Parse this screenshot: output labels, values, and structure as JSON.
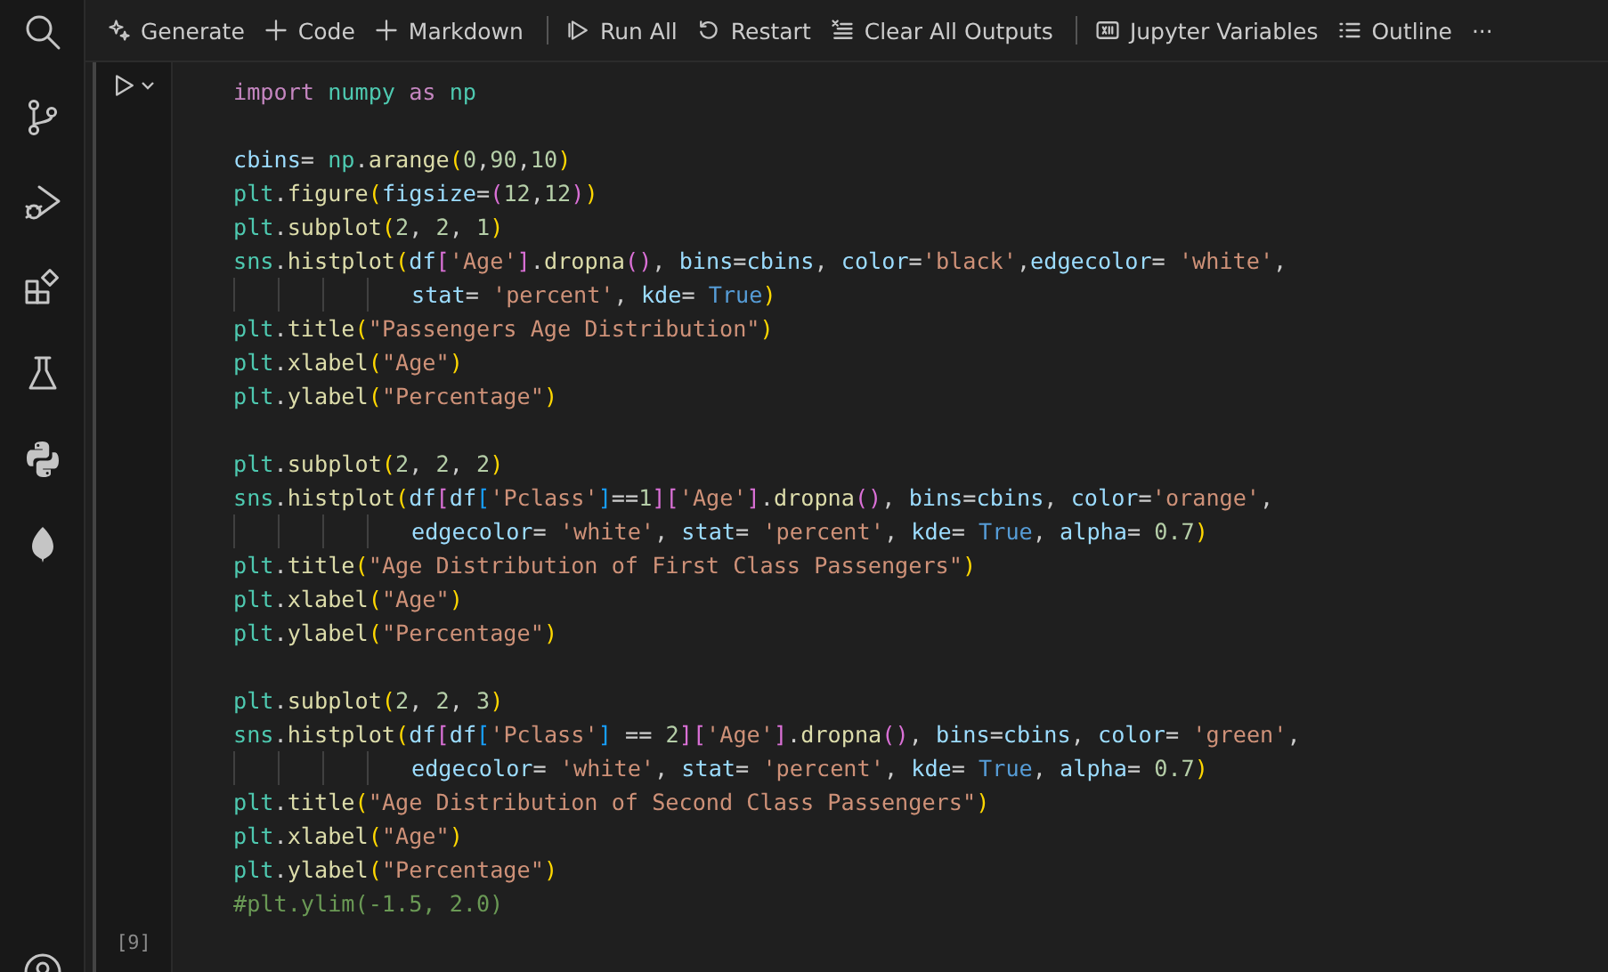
{
  "toolbar": {
    "groups": [
      {
        "items": [
          {
            "kind": "generate",
            "label": "Generate"
          },
          {
            "kind": "add",
            "label": "Code"
          },
          {
            "kind": "add",
            "label": "Markdown"
          }
        ]
      },
      {
        "items": [
          {
            "kind": "run-all",
            "label": "Run All"
          },
          {
            "kind": "restart",
            "label": "Restart"
          },
          {
            "kind": "clear",
            "label": "Clear All Outputs"
          }
        ]
      },
      {
        "items": [
          {
            "kind": "variables",
            "label": "Jupyter Variables"
          },
          {
            "kind": "outline",
            "label": "Outline"
          },
          {
            "kind": "more",
            "label": "···"
          }
        ]
      }
    ]
  },
  "cell": {
    "execution_count": "[9]",
    "lines": [
      {
        "kind": "code",
        "tokens": [
          {
            "kind": "kw",
            "text": "import "
          },
          {
            "kind": "mod",
            "text": "numpy "
          },
          {
            "kind": "kw",
            "text": "as "
          },
          {
            "kind": "mod",
            "text": "np"
          }
        ]
      },
      {
        "kind": "blank"
      },
      {
        "kind": "code",
        "tokens": [
          {
            "kind": "var",
            "text": "cbins"
          },
          {
            "kind": "p",
            "text": "= "
          },
          {
            "kind": "mod",
            "text": "np"
          },
          {
            "kind": "p",
            "text": "."
          },
          {
            "kind": "fn",
            "text": "arange"
          },
          {
            "kind": "b1",
            "text": "("
          },
          {
            "kind": "num",
            "text": "0"
          },
          {
            "kind": "p",
            "text": ","
          },
          {
            "kind": "num",
            "text": "90"
          },
          {
            "kind": "p",
            "text": ","
          },
          {
            "kind": "num",
            "text": "10"
          },
          {
            "kind": "b1",
            "text": ")"
          }
        ]
      },
      {
        "kind": "code",
        "tokens": [
          {
            "kind": "mod",
            "text": "plt"
          },
          {
            "kind": "p",
            "text": "."
          },
          {
            "kind": "fn",
            "text": "figure"
          },
          {
            "kind": "b1",
            "text": "("
          },
          {
            "kind": "var",
            "text": "figsize"
          },
          {
            "kind": "p",
            "text": "="
          },
          {
            "kind": "b2",
            "text": "("
          },
          {
            "kind": "num",
            "text": "12"
          },
          {
            "kind": "p",
            "text": ","
          },
          {
            "kind": "num",
            "text": "12"
          },
          {
            "kind": "b2",
            "text": ")"
          },
          {
            "kind": "b1",
            "text": ")"
          }
        ]
      },
      {
        "kind": "code",
        "tokens": [
          {
            "kind": "mod",
            "text": "plt"
          },
          {
            "kind": "p",
            "text": "."
          },
          {
            "kind": "fn",
            "text": "subplot"
          },
          {
            "kind": "b1",
            "text": "("
          },
          {
            "kind": "num",
            "text": "2"
          },
          {
            "kind": "p",
            "text": ", "
          },
          {
            "kind": "num",
            "text": "2"
          },
          {
            "kind": "p",
            "text": ", "
          },
          {
            "kind": "num",
            "text": "1"
          },
          {
            "kind": "b1",
            "text": ")"
          }
        ]
      },
      {
        "kind": "code",
        "tokens": [
          {
            "kind": "mod",
            "text": "sns"
          },
          {
            "kind": "p",
            "text": "."
          },
          {
            "kind": "fn",
            "text": "histplot"
          },
          {
            "kind": "b1",
            "text": "("
          },
          {
            "kind": "var",
            "text": "df"
          },
          {
            "kind": "b2",
            "text": "["
          },
          {
            "kind": "str",
            "text": "'Age'"
          },
          {
            "kind": "b2",
            "text": "]"
          },
          {
            "kind": "p",
            "text": "."
          },
          {
            "kind": "fn",
            "text": "dropna"
          },
          {
            "kind": "b2",
            "text": "()"
          },
          {
            "kind": "p",
            "text": ", "
          },
          {
            "kind": "var",
            "text": "bins"
          },
          {
            "kind": "p",
            "text": "="
          },
          {
            "kind": "var",
            "text": "cbins"
          },
          {
            "kind": "p",
            "text": ", "
          },
          {
            "kind": "var",
            "text": "color"
          },
          {
            "kind": "p",
            "text": "="
          },
          {
            "kind": "str",
            "text": "'black'"
          },
          {
            "kind": "p",
            "text": ","
          },
          {
            "kind": "var",
            "text": "edgecolor"
          },
          {
            "kind": "p",
            "text": "= "
          },
          {
            "kind": "str",
            "text": "'white'"
          },
          {
            "kind": "p",
            "text": ","
          }
        ]
      },
      {
        "kind": "continuation",
        "tokens": [
          {
            "kind": "var",
            "text": "stat"
          },
          {
            "kind": "p",
            "text": "= "
          },
          {
            "kind": "str",
            "text": "'percent'"
          },
          {
            "kind": "p",
            "text": ", "
          },
          {
            "kind": "var",
            "text": "kde"
          },
          {
            "kind": "p",
            "text": "= "
          },
          {
            "kind": "const",
            "text": "True"
          },
          {
            "kind": "b1",
            "text": ")"
          }
        ]
      },
      {
        "kind": "code",
        "tokens": [
          {
            "kind": "mod",
            "text": "plt"
          },
          {
            "kind": "p",
            "text": "."
          },
          {
            "kind": "fn",
            "text": "title"
          },
          {
            "kind": "b1",
            "text": "("
          },
          {
            "kind": "str",
            "text": "\"Passengers Age Distribution\""
          },
          {
            "kind": "b1",
            "text": ")"
          }
        ]
      },
      {
        "kind": "code",
        "tokens": [
          {
            "kind": "mod",
            "text": "plt"
          },
          {
            "kind": "p",
            "text": "."
          },
          {
            "kind": "fn",
            "text": "xlabel"
          },
          {
            "kind": "b1",
            "text": "("
          },
          {
            "kind": "str",
            "text": "\"Age\""
          },
          {
            "kind": "b1",
            "text": ")"
          }
        ]
      },
      {
        "kind": "code",
        "tokens": [
          {
            "kind": "mod",
            "text": "plt"
          },
          {
            "kind": "p",
            "text": "."
          },
          {
            "kind": "fn",
            "text": "ylabel"
          },
          {
            "kind": "b1",
            "text": "("
          },
          {
            "kind": "str",
            "text": "\"Percentage\""
          },
          {
            "kind": "b1",
            "text": ")"
          }
        ]
      },
      {
        "kind": "blank"
      },
      {
        "kind": "code",
        "tokens": [
          {
            "kind": "mod",
            "text": "plt"
          },
          {
            "kind": "p",
            "text": "."
          },
          {
            "kind": "fn",
            "text": "subplot"
          },
          {
            "kind": "b1",
            "text": "("
          },
          {
            "kind": "num",
            "text": "2"
          },
          {
            "kind": "p",
            "text": ", "
          },
          {
            "kind": "num",
            "text": "2"
          },
          {
            "kind": "p",
            "text": ", "
          },
          {
            "kind": "num",
            "text": "2"
          },
          {
            "kind": "b1",
            "text": ")"
          }
        ]
      },
      {
        "kind": "code",
        "tokens": [
          {
            "kind": "mod",
            "text": "sns"
          },
          {
            "kind": "p",
            "text": "."
          },
          {
            "kind": "fn",
            "text": "histplot"
          },
          {
            "kind": "b1",
            "text": "("
          },
          {
            "kind": "var",
            "text": "df"
          },
          {
            "kind": "b2",
            "text": "["
          },
          {
            "kind": "var",
            "text": "df"
          },
          {
            "kind": "b3",
            "text": "["
          },
          {
            "kind": "str",
            "text": "'Pclass'"
          },
          {
            "kind": "b3",
            "text": "]"
          },
          {
            "kind": "p",
            "text": "=="
          },
          {
            "kind": "num",
            "text": "1"
          },
          {
            "kind": "b2",
            "text": "]"
          },
          {
            "kind": "b2",
            "text": "["
          },
          {
            "kind": "str",
            "text": "'Age'"
          },
          {
            "kind": "b2",
            "text": "]"
          },
          {
            "kind": "p",
            "text": "."
          },
          {
            "kind": "fn",
            "text": "dropna"
          },
          {
            "kind": "b2",
            "text": "()"
          },
          {
            "kind": "p",
            "text": ", "
          },
          {
            "kind": "var",
            "text": "bins"
          },
          {
            "kind": "p",
            "text": "="
          },
          {
            "kind": "var",
            "text": "cbins"
          },
          {
            "kind": "p",
            "text": ", "
          },
          {
            "kind": "var",
            "text": "color"
          },
          {
            "kind": "p",
            "text": "="
          },
          {
            "kind": "str",
            "text": "'orange'"
          },
          {
            "kind": "p",
            "text": ","
          }
        ]
      },
      {
        "kind": "continuation",
        "tokens": [
          {
            "kind": "var",
            "text": "edgecolor"
          },
          {
            "kind": "p",
            "text": "= "
          },
          {
            "kind": "str",
            "text": "'white'"
          },
          {
            "kind": "p",
            "text": ", "
          },
          {
            "kind": "var",
            "text": "stat"
          },
          {
            "kind": "p",
            "text": "= "
          },
          {
            "kind": "str",
            "text": "'percent'"
          },
          {
            "kind": "p",
            "text": ", "
          },
          {
            "kind": "var",
            "text": "kde"
          },
          {
            "kind": "p",
            "text": "= "
          },
          {
            "kind": "const",
            "text": "True"
          },
          {
            "kind": "p",
            "text": ", "
          },
          {
            "kind": "var",
            "text": "alpha"
          },
          {
            "kind": "p",
            "text": "= "
          },
          {
            "kind": "num",
            "text": "0.7"
          },
          {
            "kind": "b1",
            "text": ")"
          }
        ]
      },
      {
        "kind": "code",
        "tokens": [
          {
            "kind": "mod",
            "text": "plt"
          },
          {
            "kind": "p",
            "text": "."
          },
          {
            "kind": "fn",
            "text": "title"
          },
          {
            "kind": "b1",
            "text": "("
          },
          {
            "kind": "str",
            "text": "\"Age Distribution of First Class Passengers\""
          },
          {
            "kind": "b1",
            "text": ")"
          }
        ]
      },
      {
        "kind": "code",
        "tokens": [
          {
            "kind": "mod",
            "text": "plt"
          },
          {
            "kind": "p",
            "text": "."
          },
          {
            "kind": "fn",
            "text": "xlabel"
          },
          {
            "kind": "b1",
            "text": "("
          },
          {
            "kind": "str",
            "text": "\"Age\""
          },
          {
            "kind": "b1",
            "text": ")"
          }
        ]
      },
      {
        "kind": "code",
        "tokens": [
          {
            "kind": "mod",
            "text": "plt"
          },
          {
            "kind": "p",
            "text": "."
          },
          {
            "kind": "fn",
            "text": "ylabel"
          },
          {
            "kind": "b1",
            "text": "("
          },
          {
            "kind": "str",
            "text": "\"Percentage\""
          },
          {
            "kind": "b1",
            "text": ")"
          }
        ]
      },
      {
        "kind": "blank"
      },
      {
        "kind": "code",
        "tokens": [
          {
            "kind": "mod",
            "text": "plt"
          },
          {
            "kind": "p",
            "text": "."
          },
          {
            "kind": "fn",
            "text": "subplot"
          },
          {
            "kind": "b1",
            "text": "("
          },
          {
            "kind": "num",
            "text": "2"
          },
          {
            "kind": "p",
            "text": ", "
          },
          {
            "kind": "num",
            "text": "2"
          },
          {
            "kind": "p",
            "text": ", "
          },
          {
            "kind": "num",
            "text": "3"
          },
          {
            "kind": "b1",
            "text": ")"
          }
        ]
      },
      {
        "kind": "code",
        "tokens": [
          {
            "kind": "mod",
            "text": "sns"
          },
          {
            "kind": "p",
            "text": "."
          },
          {
            "kind": "fn",
            "text": "histplot"
          },
          {
            "kind": "b1",
            "text": "("
          },
          {
            "kind": "var",
            "text": "df"
          },
          {
            "kind": "b2",
            "text": "["
          },
          {
            "kind": "var",
            "text": "df"
          },
          {
            "kind": "b3",
            "text": "["
          },
          {
            "kind": "str",
            "text": "'Pclass'"
          },
          {
            "kind": "b3",
            "text": "]"
          },
          {
            "kind": "p",
            "text": " == "
          },
          {
            "kind": "num",
            "text": "2"
          },
          {
            "kind": "b2",
            "text": "]"
          },
          {
            "kind": "b2",
            "text": "["
          },
          {
            "kind": "str",
            "text": "'Age'"
          },
          {
            "kind": "b2",
            "text": "]"
          },
          {
            "kind": "p",
            "text": "."
          },
          {
            "kind": "fn",
            "text": "dropna"
          },
          {
            "kind": "b2",
            "text": "()"
          },
          {
            "kind": "p",
            "text": ", "
          },
          {
            "kind": "var",
            "text": "bins"
          },
          {
            "kind": "p",
            "text": "="
          },
          {
            "kind": "var",
            "text": "cbins"
          },
          {
            "kind": "p",
            "text": ", "
          },
          {
            "kind": "var",
            "text": "color"
          },
          {
            "kind": "p",
            "text": "= "
          },
          {
            "kind": "str",
            "text": "'green'"
          },
          {
            "kind": "p",
            "text": ","
          }
        ]
      },
      {
        "kind": "continuation",
        "tokens": [
          {
            "kind": "var",
            "text": "edgecolor"
          },
          {
            "kind": "p",
            "text": "= "
          },
          {
            "kind": "str",
            "text": "'white'"
          },
          {
            "kind": "p",
            "text": ", "
          },
          {
            "kind": "var",
            "text": "stat"
          },
          {
            "kind": "p",
            "text": "= "
          },
          {
            "kind": "str",
            "text": "'percent'"
          },
          {
            "kind": "p",
            "text": ", "
          },
          {
            "kind": "var",
            "text": "kde"
          },
          {
            "kind": "p",
            "text": "= "
          },
          {
            "kind": "const",
            "text": "True"
          },
          {
            "kind": "p",
            "text": ", "
          },
          {
            "kind": "var",
            "text": "alpha"
          },
          {
            "kind": "p",
            "text": "= "
          },
          {
            "kind": "num",
            "text": "0.7"
          },
          {
            "kind": "b1",
            "text": ")"
          }
        ]
      },
      {
        "kind": "code",
        "tokens": [
          {
            "kind": "mod",
            "text": "plt"
          },
          {
            "kind": "p",
            "text": "."
          },
          {
            "kind": "fn",
            "text": "title"
          },
          {
            "kind": "b1",
            "text": "("
          },
          {
            "kind": "str",
            "text": "\"Age Distribution of Second Class Passengers\""
          },
          {
            "kind": "b1",
            "text": ")"
          }
        ]
      },
      {
        "kind": "code",
        "tokens": [
          {
            "kind": "mod",
            "text": "plt"
          },
          {
            "kind": "p",
            "text": "."
          },
          {
            "kind": "fn",
            "text": "xlabel"
          },
          {
            "kind": "b1",
            "text": "("
          },
          {
            "kind": "str",
            "text": "\"Age\""
          },
          {
            "kind": "b1",
            "text": ")"
          }
        ]
      },
      {
        "kind": "code",
        "tokens": [
          {
            "kind": "mod",
            "text": "plt"
          },
          {
            "kind": "p",
            "text": "."
          },
          {
            "kind": "fn",
            "text": "ylabel"
          },
          {
            "kind": "b1",
            "text": "("
          },
          {
            "kind": "str",
            "text": "\"Percentage\""
          },
          {
            "kind": "b1",
            "text": ")"
          }
        ]
      },
      {
        "kind": "code",
        "tokens": [
          {
            "kind": "cmt",
            "text": "#plt.ylim(-1.5, 2.0)"
          }
        ]
      }
    ]
  }
}
